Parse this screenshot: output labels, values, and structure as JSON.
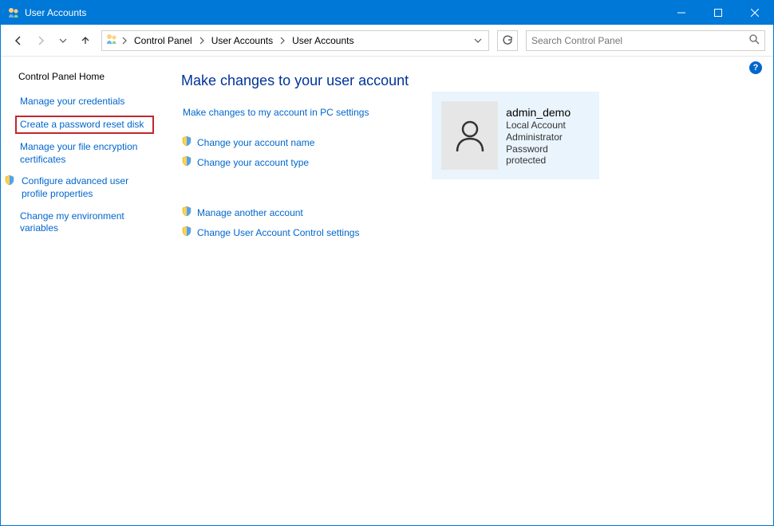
{
  "window": {
    "title": "User Accounts"
  },
  "breadcrumb": {
    "items": [
      "Control Panel",
      "User Accounts",
      "User Accounts"
    ]
  },
  "search": {
    "placeholder": "Search Control Panel"
  },
  "sidebar": {
    "title": "Control Panel Home",
    "links": {
      "manage_credentials": "Manage your credentials",
      "create_reset_disk": "Create a password reset disk",
      "manage_encryption": "Manage your file encryption certificates",
      "configure_profile": "Configure advanced user profile properties",
      "change_env": "Change my environment variables"
    }
  },
  "main": {
    "heading": "Make changes to your user account",
    "pc_settings_link": "Make changes to my account in PC settings",
    "change_name": "Change your account name",
    "change_type": "Change your account type",
    "manage_another": "Manage another account",
    "change_uac": "Change User Account Control settings"
  },
  "account": {
    "name": "admin_demo",
    "type": "Local Account",
    "role": "Administrator",
    "password_status": "Password protected"
  },
  "help": {
    "label": "?"
  },
  "colors": {
    "accent": "#0078d7",
    "link": "#0066cc",
    "heading": "#003399",
    "card_bg": "#eaf4fc",
    "highlight_border": "#c1272d"
  }
}
